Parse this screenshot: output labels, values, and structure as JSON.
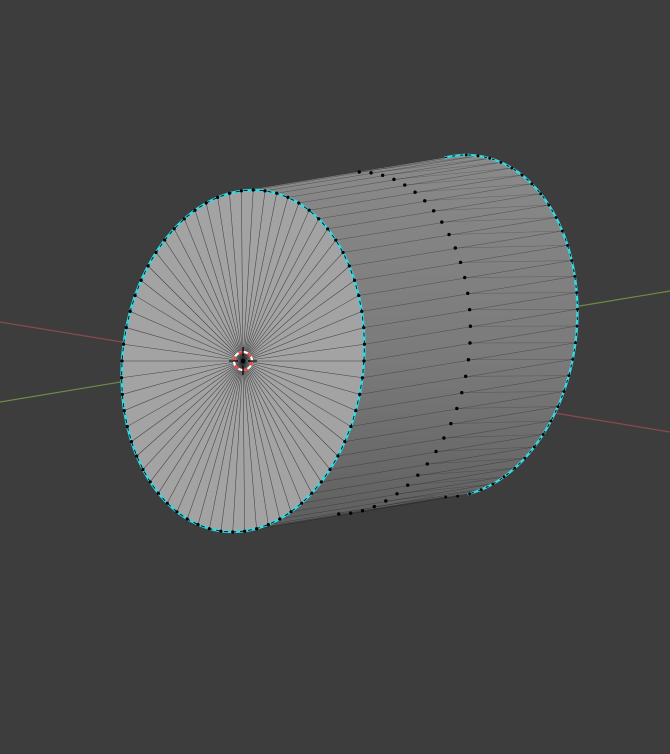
{
  "viewport": {
    "background": "#3d3d3d"
  },
  "axes": {
    "x_axis_color": "#8a4a4f",
    "y_axis_color": "#6e8a46"
  },
  "mesh": {
    "object": "cylinder",
    "segments": 64,
    "loop_cut_count": 1,
    "face_color_cap": "#a3a3a3",
    "face_color_side": "#808080",
    "face_color_shadow": "#606060",
    "wire_color": "#222222",
    "vertex_color": "#000000",
    "selection_color": "#38d6e0"
  },
  "cursor_3d": {
    "ring_color_a": "#ff4040",
    "ring_color_b": "#ffffff",
    "cross_color": "#000000"
  }
}
